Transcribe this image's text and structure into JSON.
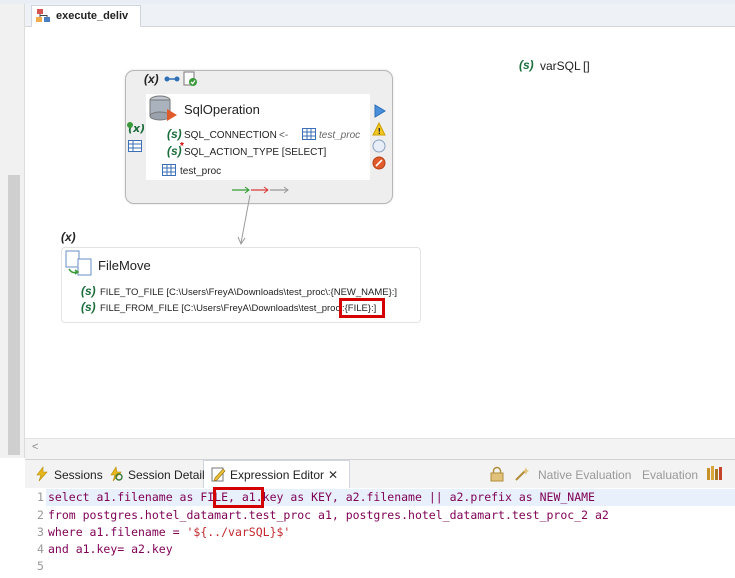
{
  "editor": {
    "tab_title": "execute_deliv"
  },
  "canvas": {
    "variable": {
      "name": "varSQL",
      "value": "[]"
    },
    "sql_node": {
      "var_marker": "(x)",
      "title": "SqlOperation",
      "params": [
        {
          "name": "SQL_CONNECTION",
          "arrow": "<-",
          "source": "test_proc"
        },
        {
          "name": "SQL_ACTION_TYPE [SELECT]"
        }
      ],
      "table": "test_proc"
    },
    "filemove_node": {
      "var_marker": "(x)",
      "title": "FileMove",
      "params": [
        "FILE_TO_FILE [C:\\Users\\FreyA\\Downloads\\test_proc\\:{NEW_NAME}:]",
        "FILE_FROM_FILE [C:\\Users\\FreyA\\Downloads\\test_proc"
      ],
      "highlight": ":{FILE}:]"
    },
    "s_glyph": "(s)"
  },
  "bottom_panel": {
    "tabs": [
      "Sessions",
      "Session Detail",
      "Expression Editor"
    ],
    "active_tab": "Expression Editor",
    "close_glyph": "✕",
    "actions": [
      "Native Evaluation",
      "Evaluation"
    ]
  },
  "code": {
    "line_numbers": [
      "1",
      "2",
      "3",
      "4",
      "5"
    ],
    "line1_before": "select a1.filename as ",
    "line1_highlight": "FILE,",
    "line1_after": " a1.key as KEY, a2.filename || a2.prefix as NEW_NAME",
    "line2": "from postgres.hotel_datamart.test_proc a1, postgres.hotel_datamart.test_proc_2 a2",
    "line3_kw": "where",
    "line3_mid": " a1.filename = ",
    "line3_str": "'${../varSQL}$'",
    "line4_kw": "and",
    "line4_rest": " a1.key= a2.key"
  },
  "colors": {
    "highlight_red": "#d40000",
    "keyword": "#7f0055",
    "string": "#c1272d",
    "var_green": "#1a6d3b"
  }
}
